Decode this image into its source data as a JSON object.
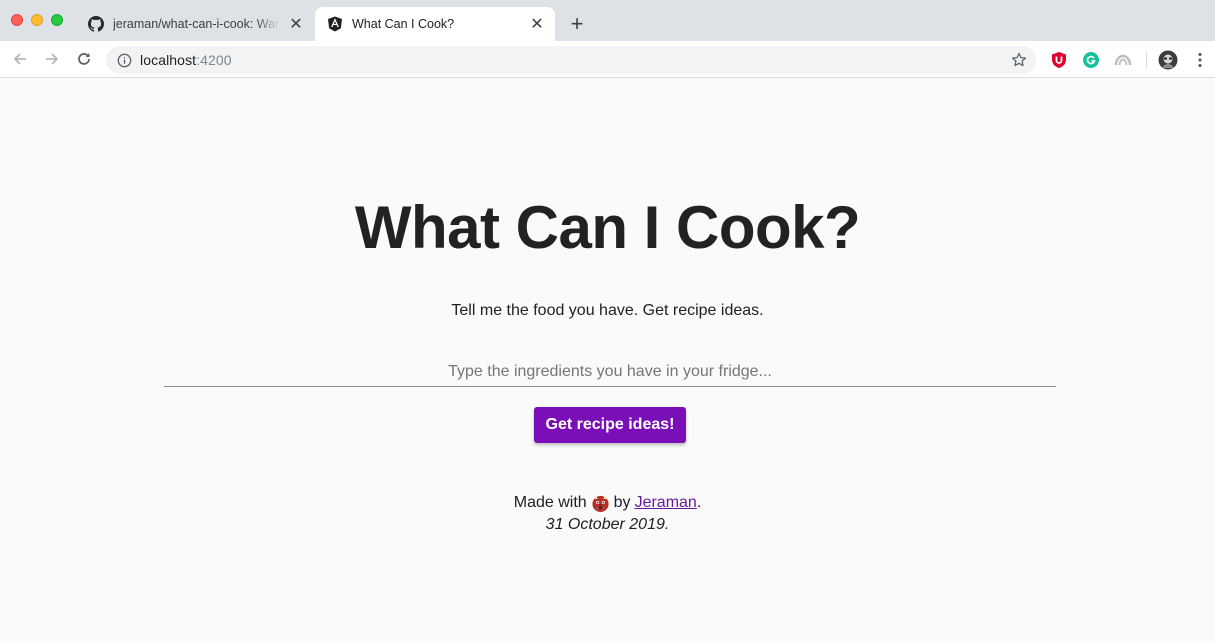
{
  "browser": {
    "tabs": [
      {
        "title": "jeraman/what-can-i-cook: Wan",
        "favicon": "github-icon",
        "active": false
      },
      {
        "title": "What Can I Cook?",
        "favicon": "angular-icon",
        "active": true
      }
    ],
    "close_glyph": "✕",
    "new_tab_glyph": "+",
    "url_host": "localhost",
    "url_port": ":4200",
    "extensions": [
      "ublock-icon",
      "grammarly-icon",
      "extension-icon"
    ]
  },
  "page": {
    "heading": "What Can I Cook?",
    "tagline": "Tell me the food you have. Get recipe ideas.",
    "search": {
      "placeholder": "Type the ingredients you have in your fridge...",
      "value": ""
    },
    "cta_label": "Get recipe ideas!",
    "footer": {
      "made_with": "Made with",
      "emoji_icon": "ogre-face-icon",
      "by": "by",
      "author": "Jeraman",
      "period": ".",
      "date": "31 October 2019."
    }
  },
  "colors": {
    "accent": "#7a0fb7",
    "link": "#6a1b9a",
    "heading": "#222222"
  }
}
